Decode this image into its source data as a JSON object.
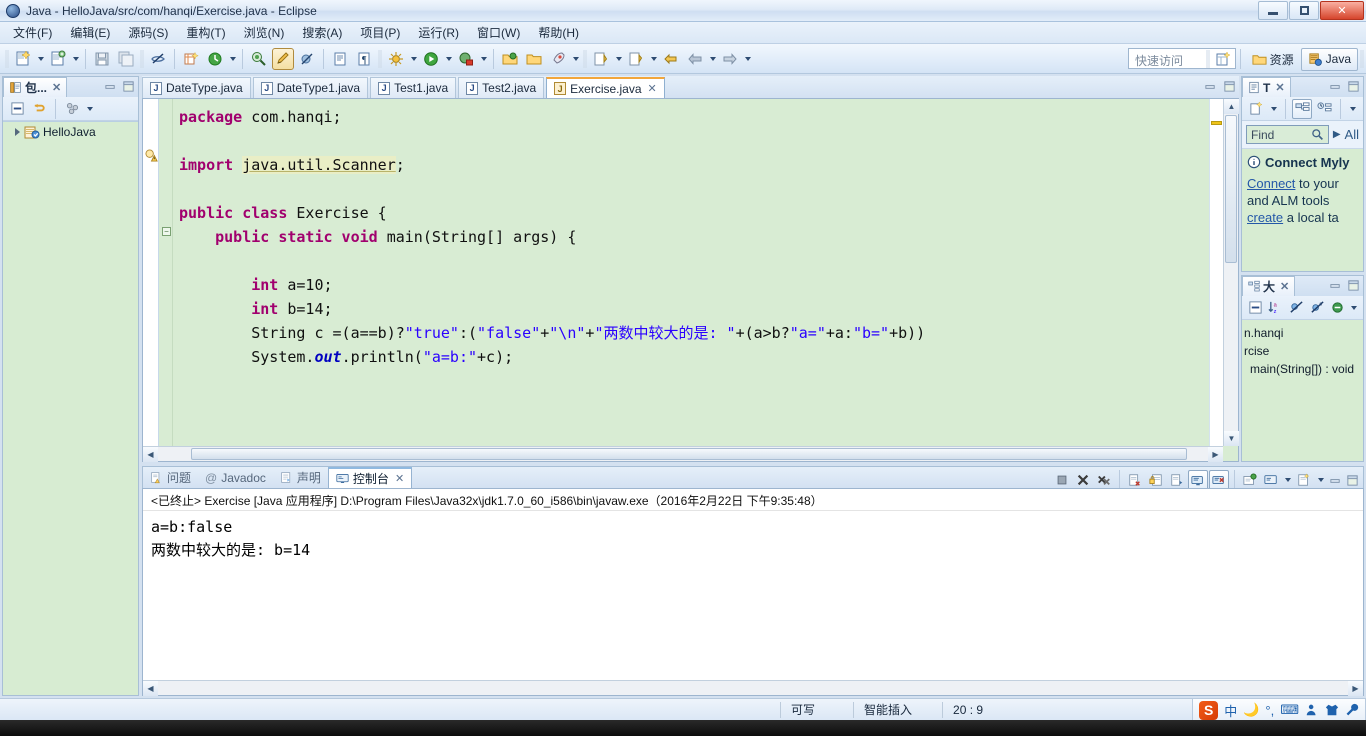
{
  "window": {
    "title": "Java - HelloJava/src/com/hanqi/Exercise.java - Eclipse",
    "app_icon": "eclipse-icon",
    "minimize": "–",
    "maximize": "❐",
    "close": "✕"
  },
  "menubar": [
    {
      "label": "文件(F)",
      "name": "menu-file"
    },
    {
      "label": "编辑(E)",
      "name": "menu-edit"
    },
    {
      "label": "源码(S)",
      "name": "menu-source"
    },
    {
      "label": "重构(T)",
      "name": "menu-refactor"
    },
    {
      "label": "浏览(N)",
      "name": "menu-navigate"
    },
    {
      "label": "搜索(A)",
      "name": "menu-search"
    },
    {
      "label": "项目(P)",
      "name": "menu-project"
    },
    {
      "label": "运行(R)",
      "name": "menu-run"
    },
    {
      "label": "窗口(W)",
      "name": "menu-window"
    },
    {
      "label": "帮助(H)",
      "name": "menu-help"
    }
  ],
  "toolbar": {
    "quick_access_placeholder": "快速访问",
    "perspective_resource": "资源",
    "perspective_java": "Java"
  },
  "package_explorer": {
    "tab_label": "包...",
    "close_glyph": "✕",
    "tree": [
      {
        "label": "HelloJava",
        "icon": "java-project-icon",
        "expanded": false
      }
    ]
  },
  "editor": {
    "tabs": [
      {
        "label": "DateType.java",
        "active": false
      },
      {
        "label": "DateType1.java",
        "active": false
      },
      {
        "label": "Test1.java",
        "active": false
      },
      {
        "label": "Test2.java",
        "active": false
      },
      {
        "label": "Exercise.java",
        "active": true
      }
    ],
    "close_glyph": "✕",
    "code_lines": [
      "package com.hanqi;",
      "",
      "import java.util.Scanner;",
      "",
      "public class Exercise {",
      "    public static void main(String[] args) {",
      "",
      "        int a=10;",
      "        int b=14;",
      "        String c =(a==b)?\"true\":(\"false\"+\"\\n\"+\"两数中较大的是: \"+(a>b?\"a=\"+a:\"b=\"+b))",
      "        System.out.println(\"a=b:\"+c);"
    ]
  },
  "console": {
    "tabs": [
      {
        "label": "问题",
        "icon": "problems-icon",
        "active": false
      },
      {
        "label": "Javadoc",
        "icon": "javadoc-icon",
        "active": false
      },
      {
        "label": "声明",
        "icon": "declaration-icon",
        "active": false
      },
      {
        "label": "控制台",
        "icon": "console-icon",
        "active": true
      }
    ],
    "close_glyph": "✕",
    "launch_header": "<已终止> Exercise [Java 应用程序] D:\\Program Files\\Java32x\\jdk1.7.0_60_i586\\bin\\javaw.exe（2016年2月22日 下午9:35:48）",
    "output_lines": [
      "a=b:false",
      "两数中较大的是: b=14"
    ]
  },
  "mylyn": {
    "tab_label": "T",
    "close_glyph": "✕",
    "find_placeholder": "Find",
    "find_all_label": "All",
    "info_title": "Connect Myly",
    "info_line1_link": "Connect",
    "info_line1_rest": " to your",
    "info_line2": "and ALM tools",
    "info_line3_link": "create",
    "info_line3_rest": " a local ta"
  },
  "outline": {
    "tab_label": "大",
    "close_glyph": "✕",
    "items": [
      "n.hanqi",
      "rcise",
      "main(String[]) : void"
    ]
  },
  "statusbar": {
    "writable": "可写",
    "insert_mode": "智能插入",
    "cursor_position": "20 : 9"
  },
  "ime": {
    "logo": "S",
    "mode": "中",
    "icons": [
      "moon-icon",
      "punctuation-icon",
      "keyboard-icon",
      "user-icon",
      "skin-icon",
      "tools-icon"
    ]
  },
  "colors": {
    "editor_background": "#d8ecd3",
    "keyword": "#a1006e",
    "string": "#2a00ff",
    "field": "#0000c0",
    "titlebar_accent": "#2b4d86",
    "active_tab_top": "#f2a63b"
  }
}
